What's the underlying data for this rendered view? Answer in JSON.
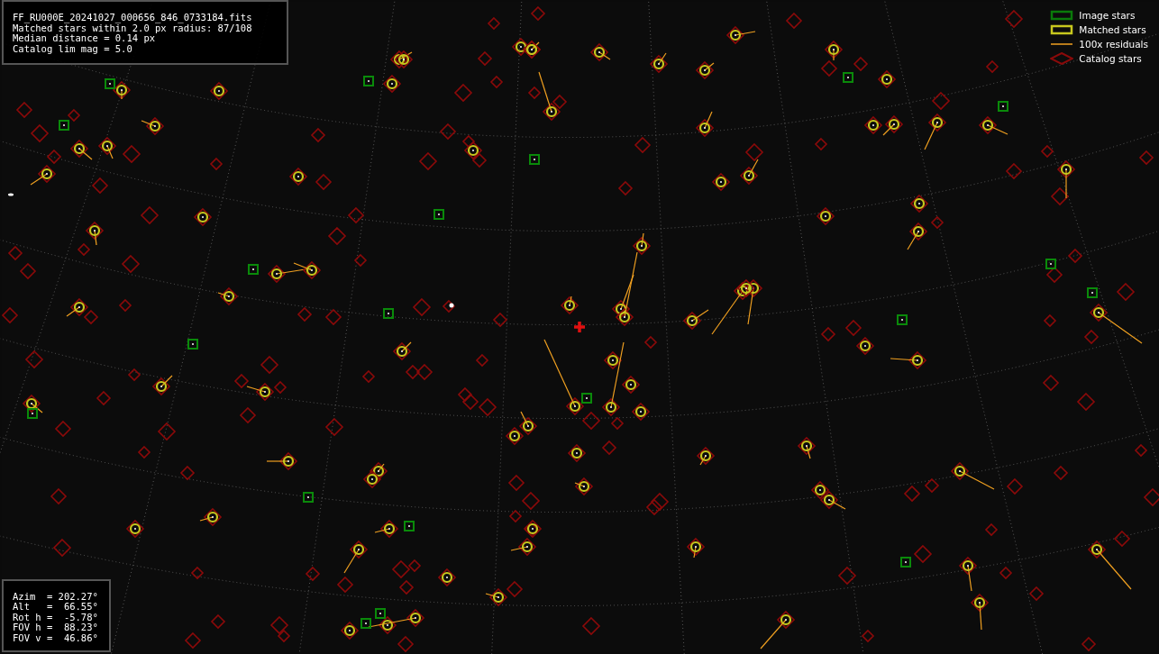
{
  "info_box": {
    "lines": [
      "FF_RU000E_20241027_000656_846_0733184.fits",
      "Matched stars within 2.0 px radius: 87/108",
      "Median distance = 0.14 px",
      "Catalog lim mag = 5.0"
    ]
  },
  "legend": {
    "items": [
      {
        "kind": "image",
        "label": "Image stars"
      },
      {
        "kind": "matched",
        "label": "Matched stars"
      },
      {
        "kind": "residual",
        "label": "100x residuals"
      },
      {
        "kind": "catalog",
        "label": "Catalog stars"
      }
    ]
  },
  "pointing_box": {
    "lines": [
      "Azim  = 202.27°",
      "Alt   =  66.55°",
      "Rot h =  -5.78°",
      "FOV h =  88.23°",
      "FOV v =  46.86°"
    ]
  }
}
